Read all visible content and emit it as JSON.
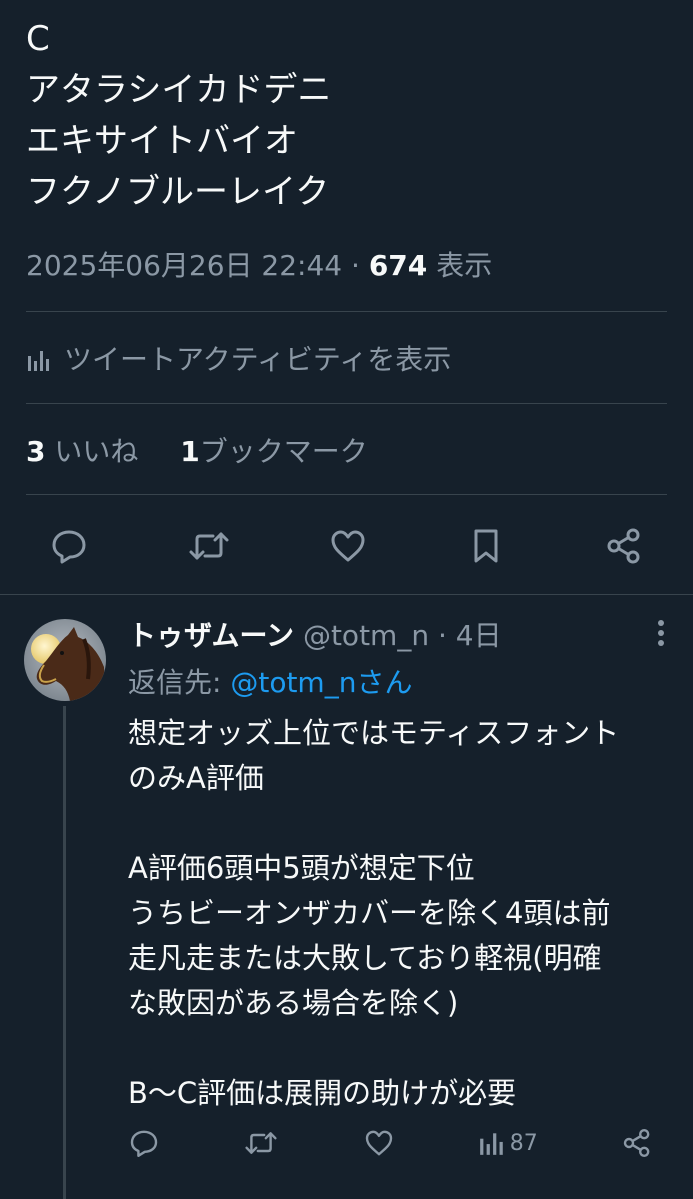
{
  "main_tweet": {
    "text_lines": [
      "C",
      "アタラシイカドデニ",
      "エキサイトバイオ",
      "フクノブルーレイク"
    ],
    "timestamp": "2025年06月26日 22:44",
    "separator": "·",
    "views_count": "674",
    "views_label": "表示",
    "activity_label": "ツイートアクティビティを表示",
    "likes_count": "3",
    "likes_label": "いいね",
    "bookmarks_count": "1",
    "bookmarks_label": "ブックマーク"
  },
  "actions": [
    "reply-icon",
    "retweet-icon",
    "heart-icon",
    "bookmark-icon",
    "share-icon"
  ],
  "reply": {
    "display_name": "トゥザムーン",
    "handle": "@totm_n",
    "separator": "·",
    "time": "4日",
    "replying_prefix": "返信先: ",
    "replying_mention": "@totm_nさん",
    "text_lines": [
      "想定オッズ上位ではモティスフォント",
      "のみA評価",
      "",
      "A評価6頭中5頭が想定下位",
      "うちビーオンザカバーを除く4頭は前",
      "走凡走または大敗しており軽視(明確",
      "な敗因がある場合を除く)",
      "",
      "B〜C評価は展開の助けが必要"
    ],
    "view_count": "87"
  },
  "colors": {
    "background": "#15202b",
    "text": "#f7f9f9",
    "secondary": "#8b98a5",
    "accent": "#1d9bf0",
    "border": "#38444d"
  }
}
